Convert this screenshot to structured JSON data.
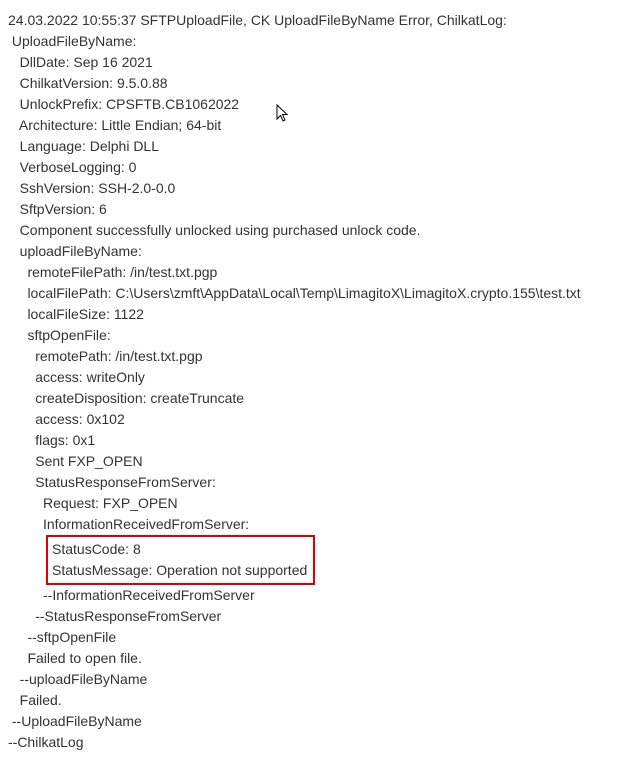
{
  "header": "24.03.2022 10:55:37 SFTPUploadFile, CK UploadFileByName Error, ChilkatLog:",
  "l1": " UploadFileByName:",
  "l2": "   DllDate: Sep 16 2021",
  "l3": "   ChilkatVersion: 9.5.0.88",
  "l4": "   UnlockPrefix: CPSFTB.CB1062022",
  "l5": "   Architecture: Little Endian; 64-bit",
  "l6": "   Language: Delphi DLL",
  "l7": "   VerboseLogging: 0",
  "l8": "   SshVersion: SSH-2.0-0.0",
  "l9": "   SftpVersion: 6",
  "l10": "   Component successfully unlocked using purchased unlock code.",
  "l11": "   uploadFileByName:",
  "l12": "     remoteFilePath: /in/test.txt.pgp",
  "l13": "     localFilePath: C:\\Users\\zmft\\AppData\\Local\\Temp\\LimagitoX\\LimagitoX.crypto.155\\test.txt",
  "l14": "     localFileSize: 1122",
  "l15": "     sftpOpenFile:",
  "l16": "       remotePath: /in/test.txt.pgp",
  "l17": "       access: writeOnly",
  "l18": "       createDisposition: createTruncate",
  "l19": "       access: 0x102",
  "l20": "       flags: 0x1",
  "l21": "       Sent FXP_OPEN",
  "l22": "       StatusResponseFromServer:",
  "l23": "         Request: FXP_OPEN",
  "l24": "         InformationReceivedFromServer:",
  "l25a": "           StatusCode: 8",
  "l25b": "           StatusMessage: Operation not supported",
  "l26": "         --InformationReceivedFromServer",
  "l27": "       --StatusResponseFromServer",
  "l28": "     --sftpOpenFile",
  "l29": "     Failed to open file.",
  "l30": "   --uploadFileByName",
  "l31": "   Failed.",
  "l32": " --UploadFileByName",
  "l33": "--ChilkatLog"
}
